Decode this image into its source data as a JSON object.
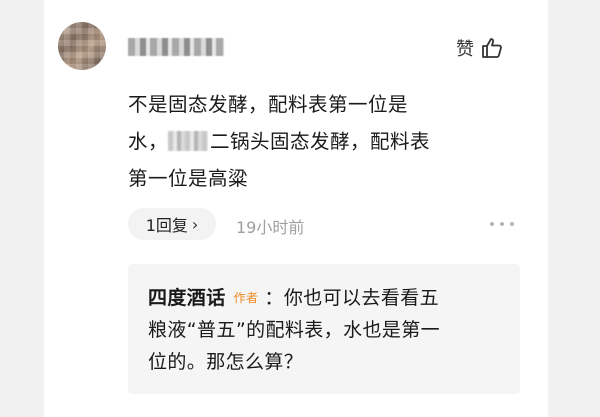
{
  "comment": {
    "like_label": "赞",
    "content_lines": [
      "不是固态发酵，配料表第一位是",
      "二锅头固态发酵，配料表",
      "第一位是高粱"
    ],
    "content_line2_prefix": "水，",
    "reply_count_label": "1回复",
    "time": "19小时前"
  },
  "reply": {
    "author": "四度酒话",
    "author_badge": "作者",
    "separator": "：",
    "lines": [
      "你也可以去看看五",
      "粮液“普五”的配料表，水也是第一",
      "位的。那怎么算？"
    ]
  }
}
